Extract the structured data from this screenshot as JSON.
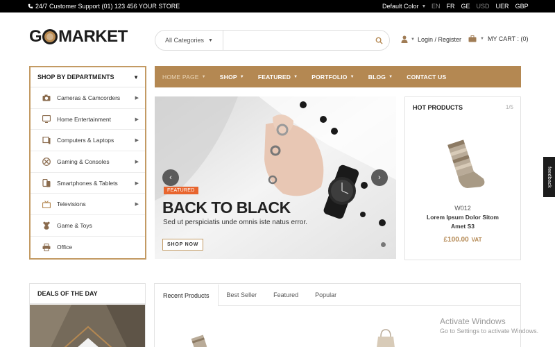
{
  "topbar": {
    "support": "24/7 Customer Support (01) 123 456 YOUR STORE",
    "color_select": "Default Color",
    "languages": [
      "EN",
      "FR",
      "GE"
    ],
    "currencies": [
      "USD",
      "UER",
      "GBP"
    ]
  },
  "header": {
    "logo_left": "G",
    "logo_right": "MARKET",
    "search": {
      "category": "All Categories",
      "placeholder": ""
    },
    "account_label": "Login / Register",
    "cart_label": "MY CART : (0)"
  },
  "departments": {
    "title": "SHOP BY DEPARTMENTS",
    "items": [
      {
        "label": "Cameras & Camcorders",
        "icon": "camera-icon",
        "has_sub": true
      },
      {
        "label": "Home Entertainment",
        "icon": "tv-icon",
        "has_sub": true
      },
      {
        "label": "Computers & Laptops",
        "icon": "laptop-icon",
        "has_sub": true
      },
      {
        "label": "Gaming & Consoles",
        "icon": "gamepad-icon",
        "has_sub": true
      },
      {
        "label": "Smartphones & Tablets",
        "icon": "smartphone-icon",
        "has_sub": true
      },
      {
        "label": "Televisions",
        "icon": "television-icon",
        "has_sub": true
      },
      {
        "label": "Game & Toys",
        "icon": "teddy-bear-icon",
        "has_sub": false
      },
      {
        "label": "Office",
        "icon": "printer-icon",
        "has_sub": false
      }
    ]
  },
  "nav": {
    "items": [
      {
        "label": "HOME PAGE",
        "dropdown": true,
        "active": true
      },
      {
        "label": "SHOP",
        "dropdown": true
      },
      {
        "label": "FEATURED",
        "dropdown": true
      },
      {
        "label": "PORTFOLIO",
        "dropdown": true
      },
      {
        "label": "BLOG",
        "dropdown": true
      },
      {
        "label": "CONTACT US",
        "dropdown": false
      }
    ]
  },
  "hero": {
    "badge": "FEATURED",
    "title": "BACK TO BLACK",
    "subtitle": "Sed ut perspiciatis unde omnis iste natus error.",
    "cta": "SHOP NOW",
    "prev_symbol": "‹",
    "next_symbol": "›"
  },
  "hot_products": {
    "title": "HOT PRODUCTS",
    "pager": "1/5",
    "product": {
      "code": "W012",
      "name": "Lorem Ipsum Dolor Sitom Amet S3",
      "price": "£100.00",
      "vat": "VAT"
    }
  },
  "feedback": {
    "label": "feedback"
  },
  "deals": {
    "title": "DEALS OF THE DAY"
  },
  "product_tabs": {
    "tabs": [
      "Recent Products",
      "Best Seller",
      "Featured",
      "Popular"
    ]
  },
  "watermark": {
    "line1": "Activate Windows",
    "line2": "Go to Settings to activate Windows."
  },
  "colors": {
    "accent": "#b48852",
    "border_accent": "#c39a63",
    "badge": "#e8652e",
    "topbar": "#000000"
  }
}
